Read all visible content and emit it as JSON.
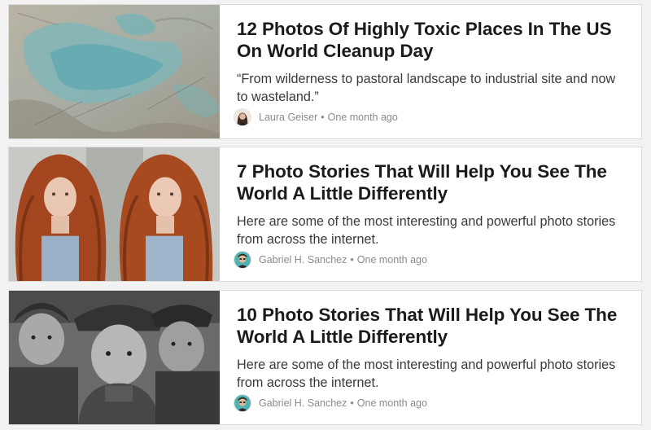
{
  "articles": [
    {
      "title": "12 Photos Of Highly Toxic Places In The US On World Cleanup Day",
      "excerpt": "“From wilderness to pastoral landscape to industrial site and now to wasteland.”",
      "author": "Laura Geiser",
      "separator": "•",
      "time": "One month ago",
      "thumbnail_icon": "toxic-landscape-aerial-photo"
    },
    {
      "title": "7 Photo Stories That Will Help You See The World A Little Differently",
      "excerpt": "Here are some of the most interesting and powerful photo stories from across the internet.",
      "author": "Gabriel H. Sanchez",
      "separator": "•",
      "time": "One month ago",
      "thumbnail_icon": "red-haired-twins-photo"
    },
    {
      "title": "10 Photo Stories That Will Help You See The World A Little Differently",
      "excerpt": "Here are some of the most interesting and powerful photo stories from across the internet.",
      "author": "Gabriel H. Sanchez",
      "separator": "•",
      "time": "One month ago",
      "thumbnail_icon": "child-laborers-vintage-photo"
    }
  ],
  "colors": {
    "background": "#f2f2f2",
    "card": "#ffffff",
    "headline": "#1b1b1b",
    "excerpt": "#3a3a3a",
    "meta": "#8a8a8a"
  }
}
